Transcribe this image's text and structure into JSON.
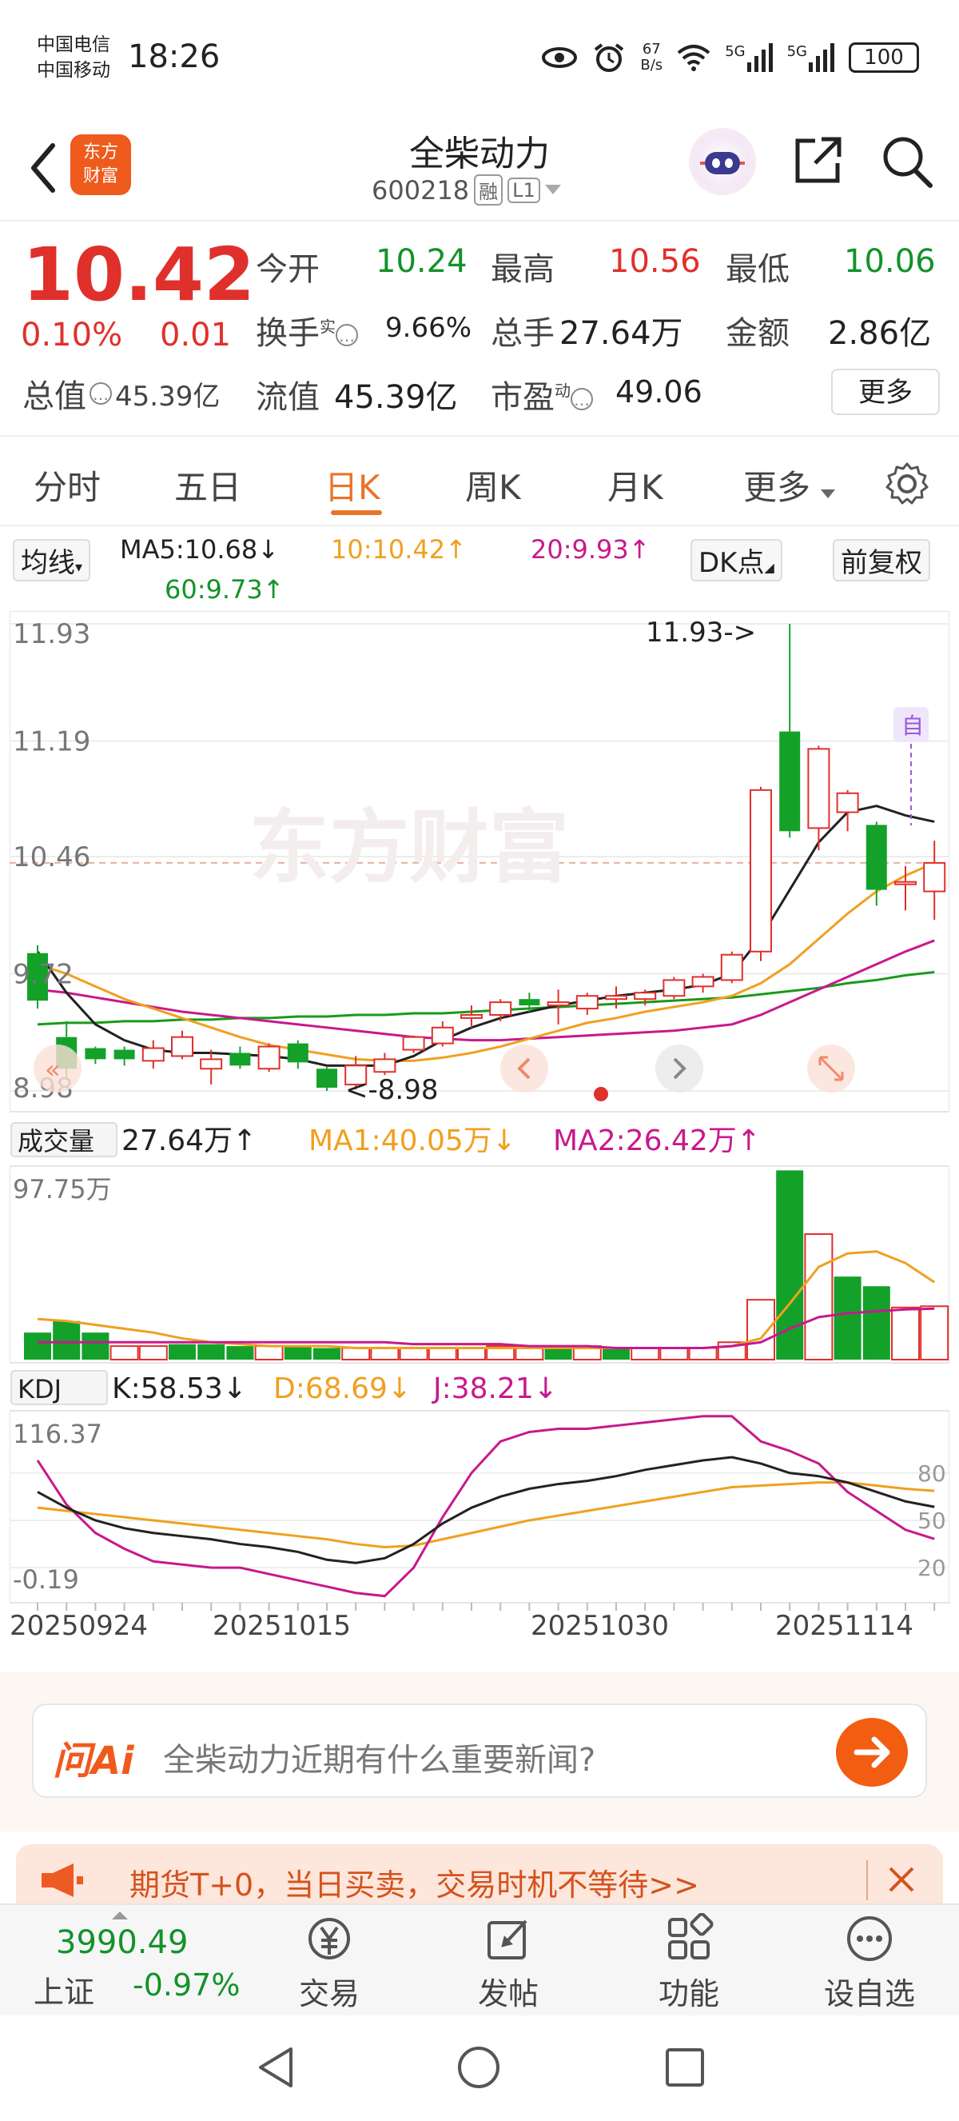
{
  "status_bar": {
    "carrier_1": "中国电信",
    "carrier_2": "中国移动",
    "time": "18:26",
    "net_speed_value": "67",
    "net_speed_unit": "B/s",
    "signal_1": "5G",
    "signal_2": "5G",
    "battery": "100"
  },
  "header": {
    "logo_line1": "东方",
    "logo_line2": "财富",
    "stock_name": "全柴动力",
    "stock_code": "600218",
    "badge_margin": "融",
    "badge_level": "L1"
  },
  "quote": {
    "price": "10.42",
    "change_pct": "0.10%",
    "change_abs": "0.01",
    "market_cap_label": "总值",
    "market_cap_value": "45.39亿",
    "open_label": "今开",
    "open_value": "10.24",
    "high_label": "最高",
    "high_value": "10.56",
    "low_label": "最低",
    "low_value": "10.06",
    "turnover_label": "换手",
    "turnover_sup": "实",
    "turnover_value": "9.66%",
    "volume_label": "总手",
    "volume_value": "27.64万",
    "amount_label": "金额",
    "amount_value": "2.86亿",
    "float_cap_label": "流值",
    "float_cap_value": "45.39亿",
    "pe_label": "市盈",
    "pe_sup": "动",
    "pe_value": "49.06",
    "more_label": "更多"
  },
  "tabs": [
    "分时",
    "五日",
    "日K",
    "周K",
    "月K",
    "更多"
  ],
  "active_tab": "日K",
  "ma_legend": {
    "selector": "均线",
    "ma5": "MA5:10.68↓",
    "ma10": "10:10.42↑",
    "ma20": "20:9.93↑",
    "ma60": "60:9.73↑",
    "dk_button": "DK点",
    "adjust_button": "前复权"
  },
  "volume_legend": {
    "selector": "成交量",
    "value": "27.64万↑",
    "ma1": "MA1:40.05万↓",
    "ma2": "MA2:26.42万↑"
  },
  "kdj_legend": {
    "selector": "KDJ",
    "k": "K:58.53↓",
    "d": "D:68.69↓",
    "j": "J:38.21↓"
  },
  "colors": {
    "up": "#e0302b",
    "down": "#13a12a",
    "ma5": "#222222",
    "ma10": "#f0a020",
    "ma20": "#c8198c",
    "ma60": "#1a9a1a",
    "accent": "#e8742a"
  },
  "chart_data": [
    {
      "type": "candlestick",
      "title": "",
      "y_tick_labels": [
        "11.93",
        "11.19",
        "10.46",
        "9.72",
        "8.98"
      ],
      "ylim": [
        8.98,
        11.93
      ],
      "annotations": {
        "high_marker": "11.93->",
        "low_marker": "<-8.98",
        "self_select_marker": "自"
      },
      "x_tick_labels": [
        "20250924",
        "20251015",
        "20251030",
        "20251114"
      ],
      "candles": [
        {
          "o": 9.85,
          "h": 9.9,
          "l": 9.5,
          "c": 9.55
        },
        {
          "o": 9.32,
          "h": 9.42,
          "l": 9.05,
          "c": 9.12
        },
        {
          "o": 9.25,
          "h": 9.26,
          "l": 9.15,
          "c": 9.18
        },
        {
          "o": 9.24,
          "h": 9.26,
          "l": 9.14,
          "c": 9.18
        },
        {
          "o": 9.17,
          "h": 9.3,
          "l": 9.12,
          "c": 9.25
        },
        {
          "o": 9.2,
          "h": 9.36,
          "l": 9.18,
          "c": 9.32
        },
        {
          "o": 9.12,
          "h": 9.24,
          "l": 9.02,
          "c": 9.18
        },
        {
          "o": 9.22,
          "h": 9.26,
          "l": 9.12,
          "c": 9.14
        },
        {
          "o": 9.12,
          "h": 9.28,
          "l": 9.1,
          "c": 9.26
        },
        {
          "o": 9.28,
          "h": 9.3,
          "l": 9.12,
          "c": 9.16
        },
        {
          "o": 9.12,
          "h": 9.13,
          "l": 8.98,
          "c": 9.0
        },
        {
          "o": 9.02,
          "h": 9.2,
          "l": 8.99,
          "c": 9.14
        },
        {
          "o": 9.1,
          "h": 9.22,
          "l": 9.08,
          "c": 9.18
        },
        {
          "o": 9.24,
          "h": 9.33,
          "l": 9.22,
          "c": 9.32
        },
        {
          "o": 9.28,
          "h": 9.42,
          "l": 9.26,
          "c": 9.38
        },
        {
          "o": 9.44,
          "h": 9.52,
          "l": 9.38,
          "c": 9.46
        },
        {
          "o": 9.46,
          "h": 9.56,
          "l": 9.42,
          "c": 9.54
        },
        {
          "o": 9.56,
          "h": 9.6,
          "l": 9.48,
          "c": 9.52
        },
        {
          "o": 9.52,
          "h": 9.62,
          "l": 9.4,
          "c": 9.54
        },
        {
          "o": 9.5,
          "h": 9.6,
          "l": 9.46,
          "c": 9.58
        },
        {
          "o": 9.56,
          "h": 9.64,
          "l": 9.5,
          "c": 9.58
        },
        {
          "o": 9.56,
          "h": 9.62,
          "l": 9.52,
          "c": 9.6
        },
        {
          "o": 9.58,
          "h": 9.7,
          "l": 9.56,
          "c": 9.68
        },
        {
          "o": 9.64,
          "h": 9.72,
          "l": 9.6,
          "c": 9.7
        },
        {
          "o": 9.68,
          "h": 9.86,
          "l": 9.66,
          "c": 9.84
        },
        {
          "o": 9.86,
          "h": 10.9,
          "l": 9.8,
          "c": 10.88
        },
        {
          "o": 11.25,
          "h": 11.93,
          "l": 10.58,
          "c": 10.62
        },
        {
          "o": 10.64,
          "h": 11.16,
          "l": 10.5,
          "c": 11.14
        },
        {
          "o": 10.74,
          "h": 10.88,
          "l": 10.62,
          "c": 10.86
        },
        {
          "o": 10.66,
          "h": 10.68,
          "l": 10.15,
          "c": 10.25
        },
        {
          "o": 10.3,
          "h": 10.4,
          "l": 10.12,
          "c": 10.3
        },
        {
          "o": 10.24,
          "h": 10.56,
          "l": 10.06,
          "c": 10.42
        }
      ],
      "ma5": [
        9.86,
        9.6,
        9.4,
        9.3,
        9.24,
        9.22,
        9.22,
        9.21,
        9.2,
        9.18,
        9.14,
        9.14,
        9.14,
        9.2,
        9.3,
        9.38,
        9.44,
        9.48,
        9.52,
        9.55,
        9.58,
        9.6,
        9.62,
        9.65,
        9.72,
        9.95,
        10.25,
        10.55,
        10.74,
        10.78,
        10.72,
        10.68
      ],
      "ma10": [
        9.78,
        9.72,
        9.64,
        9.56,
        9.5,
        9.44,
        9.38,
        9.32,
        9.27,
        9.24,
        9.21,
        9.18,
        9.17,
        9.17,
        9.19,
        9.22,
        9.26,
        9.31,
        9.36,
        9.41,
        9.44,
        9.48,
        9.51,
        9.54,
        9.58,
        9.66,
        9.78,
        9.94,
        10.1,
        10.24,
        10.34,
        10.42
      ],
      "ma20": [
        9.62,
        9.6,
        9.57,
        9.54,
        9.51,
        9.48,
        9.46,
        9.44,
        9.42,
        9.4,
        9.38,
        9.36,
        9.34,
        9.32,
        9.31,
        9.3,
        9.3,
        9.31,
        9.32,
        9.33,
        9.34,
        9.35,
        9.36,
        9.38,
        9.4,
        9.46,
        9.54,
        9.62,
        9.7,
        9.78,
        9.86,
        9.93
      ],
      "ma60": [
        9.4,
        9.41,
        9.41,
        9.42,
        9.42,
        9.43,
        9.43,
        9.44,
        9.44,
        9.45,
        9.45,
        9.46,
        9.46,
        9.47,
        9.47,
        9.48,
        9.49,
        9.5,
        9.51,
        9.52,
        9.53,
        9.54,
        9.55,
        9.56,
        9.57,
        9.59,
        9.61,
        9.63,
        9.66,
        9.68,
        9.71,
        9.73
      ]
    },
    {
      "type": "bar",
      "title": "成交量",
      "y_tick_labels": [
        "97.75万"
      ],
      "ylim": [
        0,
        97.75
      ],
      "unit": "万",
      "values": [
        14,
        20,
        14,
        7,
        7,
        8,
        8,
        7,
        7,
        7,
        6,
        6,
        6,
        6,
        6,
        6,
        7,
        7,
        6,
        7,
        6,
        6,
        6,
        6,
        9,
        31,
        98,
        65,
        43,
        38,
        27,
        27.64
      ],
      "up": [
        false,
        false,
        false,
        true,
        true,
        false,
        false,
        false,
        true,
        false,
        false,
        true,
        true,
        true,
        true,
        true,
        true,
        true,
        false,
        true,
        false,
        true,
        true,
        true,
        true,
        true,
        false,
        true,
        false,
        false,
        true,
        true
      ],
      "ma1": [
        21,
        20,
        18,
        16,
        14,
        11,
        9,
        8,
        7,
        7,
        7,
        6,
        6,
        6,
        6,
        6,
        6,
        6,
        6,
        6,
        6,
        6,
        6,
        6,
        7,
        11,
        29,
        48,
        55,
        56,
        50,
        40.05
      ],
      "ma2": [
        9,
        9,
        9,
        9,
        9,
        9,
        9,
        9,
        9,
        9,
        9,
        9,
        9,
        8,
        8,
        8,
        8,
        7,
        7,
        7,
        6,
        6,
        6,
        6,
        7,
        9,
        16,
        22,
        24,
        25,
        26,
        26.42
      ]
    },
    {
      "type": "line",
      "title": "KDJ",
      "y_tick_labels": [
        "116.37",
        "-0.19"
      ],
      "right_tick_labels": [
        "80",
        "50",
        "20"
      ],
      "ylim": [
        -0.19,
        116.37
      ],
      "k": [
        68,
        58,
        50,
        45,
        42,
        40,
        38,
        35,
        33,
        30,
        25,
        23,
        26,
        35,
        48,
        58,
        65,
        70,
        73,
        75,
        78,
        82,
        85,
        88,
        90,
        86,
        80,
        78,
        74,
        68,
        62,
        58.53
      ],
      "d": [
        58,
        56,
        54,
        52,
        50,
        48,
        46,
        44,
        42,
        40,
        38,
        35,
        33,
        34,
        38,
        42,
        46,
        50,
        53,
        56,
        59,
        62,
        65,
        68,
        71,
        72,
        73,
        74,
        74,
        72,
        70,
        68.69
      ],
      "j": [
        88,
        60,
        42,
        32,
        24,
        22,
        20,
        20,
        16,
        12,
        8,
        4,
        2,
        20,
        52,
        80,
        100,
        106,
        108,
        108,
        110,
        112,
        114,
        116,
        116,
        100,
        94,
        86,
        68,
        56,
        44,
        38.21
      ]
    }
  ],
  "ai_bar": {
    "logo": "问Ai",
    "prompt": "全柴动力近期有什么重要新闻?"
  },
  "banner": {
    "text": "期货T+0，当日买卖，交易时机不等待>>"
  },
  "bottom_nav": {
    "index_value": "3990.49",
    "index_name": "上证",
    "index_change": "-0.97%",
    "items": [
      "交易",
      "发帖",
      "功能",
      "设自选"
    ]
  }
}
